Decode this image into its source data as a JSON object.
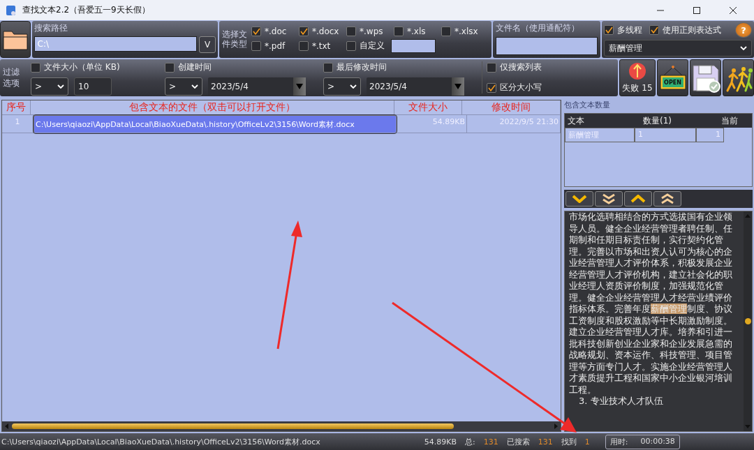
{
  "window": {
    "title": "查找文本2.2（吾爱五一9天长假）"
  },
  "toolbar": {
    "path_label": "搜索路径",
    "path_value": "C:\\",
    "path_button": "V",
    "filetype_label": "选择文件类型",
    "file_types": [
      {
        "label": "*.doc",
        "checked": true
      },
      {
        "label": "*.docx",
        "checked": true
      },
      {
        "label": "*.wps",
        "checked": false
      },
      {
        "label": "*.xls",
        "checked": false
      },
      {
        "label": "*.xlsx",
        "checked": false
      },
      {
        "label": "*.pdf",
        "checked": false
      },
      {
        "label": "*.txt",
        "checked": false
      },
      {
        "label": "自定义",
        "checked": false
      }
    ],
    "filename_label": "文件名（使用通配符）",
    "options": [
      {
        "label": "多线程",
        "checked": true
      },
      {
        "label": "使用正则表达式",
        "checked": true
      }
    ],
    "help_button": "?",
    "search_text": "薪酬管理"
  },
  "filters": {
    "label": "过滤选项",
    "size": {
      "label": "文件大小（单位 KB)",
      "checked": false,
      "operator": ">",
      "value": "10"
    },
    "created": {
      "label": "创建时间",
      "checked": false,
      "operator": ">",
      "date": "2023/5/4"
    },
    "modified": {
      "label": "最后修改时间",
      "checked": false,
      "operator": ">",
      "date": "2023/5/4"
    },
    "list_only": {
      "label": "仅搜索列表",
      "checked": false
    },
    "case_sensitive": {
      "label": "区分大小写",
      "checked": true
    }
  },
  "actions": {
    "fail_label": "失败 15",
    "open_sign": "OPEN"
  },
  "results": {
    "columns": [
      "序号",
      "包含文本的文件（双击可以打开文件）",
      "文件大小",
      "修改时间"
    ],
    "rows": [
      {
        "cells": [
          "1",
          "C:\\Users\\qiaozi\\AppData\\Local\\BiaoXueData\\.history\\OfficeLv2\\3156\\Word素材.docx",
          "54.89KB",
          "2022/9/5 21:30"
        ],
        "selected": true
      }
    ]
  },
  "counts": {
    "title": "包含文本数量",
    "columns": [
      "文本",
      "数量(1)",
      "当前"
    ],
    "rows": [
      [
        "薪酬管理",
        "1",
        "1"
      ]
    ]
  },
  "preview": {
    "segments": [
      {
        "text": "市场化选聘相结合的方式选拔国有企业领导人员。健全企业经营管理者聘任制、任期制和任期目标责任制，实行契约化管理。完善以市场和出资人认可为核心的企业经营管理人才评价体系，积极发展企业经营管理人才评价机构，建立社会化的职业经理人资质评价制度，加强规范化管理。健全企业经营管理人才经营业绩评价指标体系。完善年度",
        "highlight": false
      },
      {
        "text": "薪酬管理",
        "highlight": true
      },
      {
        "text": "制度、协议工资制度和股权激励等中长期激励制度。建立企业经营管理人才库。培养和引进一批科技创新创业企业家和企业发展急需的战略规划、资本运作、科技管理、项目管理等方面专门人才。实施企业经营管理人才素质提升工程和国家中小企业银河培训工程。",
        "highlight": false
      }
    ],
    "heading": "3. 专业技术人才队伍"
  },
  "status_bar": {
    "path": "C:\\Users\\qiaozi\\AppData\\Local\\BiaoXueData\\.history\\OfficeLv2\\3156\\Word素材.docx",
    "size": "54.89KB",
    "total_label": "总:",
    "total": "131",
    "searched_label": "已搜索",
    "searched": "131",
    "found_label": "找到",
    "found": "1",
    "time_label": "用时:",
    "time": "00:00:38"
  }
}
